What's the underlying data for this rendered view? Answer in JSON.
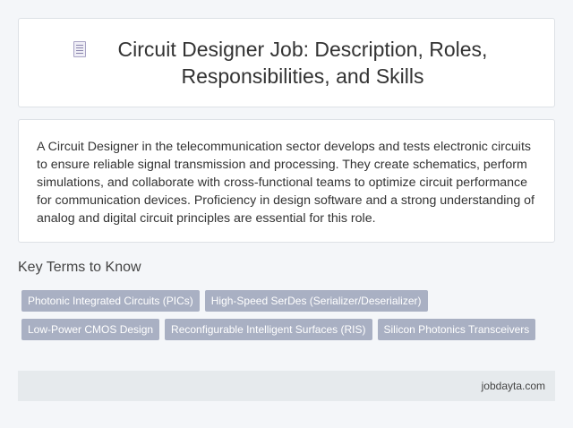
{
  "header": {
    "icon": "document-icon",
    "title": "Circuit Designer Job: Description, Roles, Responsibilities, and Skills"
  },
  "description": {
    "text": "A Circuit Designer in the telecommunication sector develops and tests electronic circuits to ensure reliable signal transmission and processing. They create schematics, perform simulations, and collaborate with cross-functional teams to optimize circuit performance for communication devices. Proficiency in design software and a strong understanding of analog and digital circuit principles are essential for this role."
  },
  "key_terms": {
    "heading": "Key Terms to Know",
    "tags": [
      "Photonic Integrated Circuits (PICs)",
      "High-Speed SerDes (Serializer/Deserializer)",
      "Low-Power CMOS Design",
      "Reconfigurable Intelligent Surfaces (RIS)",
      "Silicon Photonics Transceivers"
    ]
  },
  "footer": {
    "brand": "jobdayta.com"
  },
  "colors": {
    "background": "#f4f6f9",
    "card": "#ffffff",
    "tag": "#a9b0c3",
    "footer": "#e6eaed"
  }
}
